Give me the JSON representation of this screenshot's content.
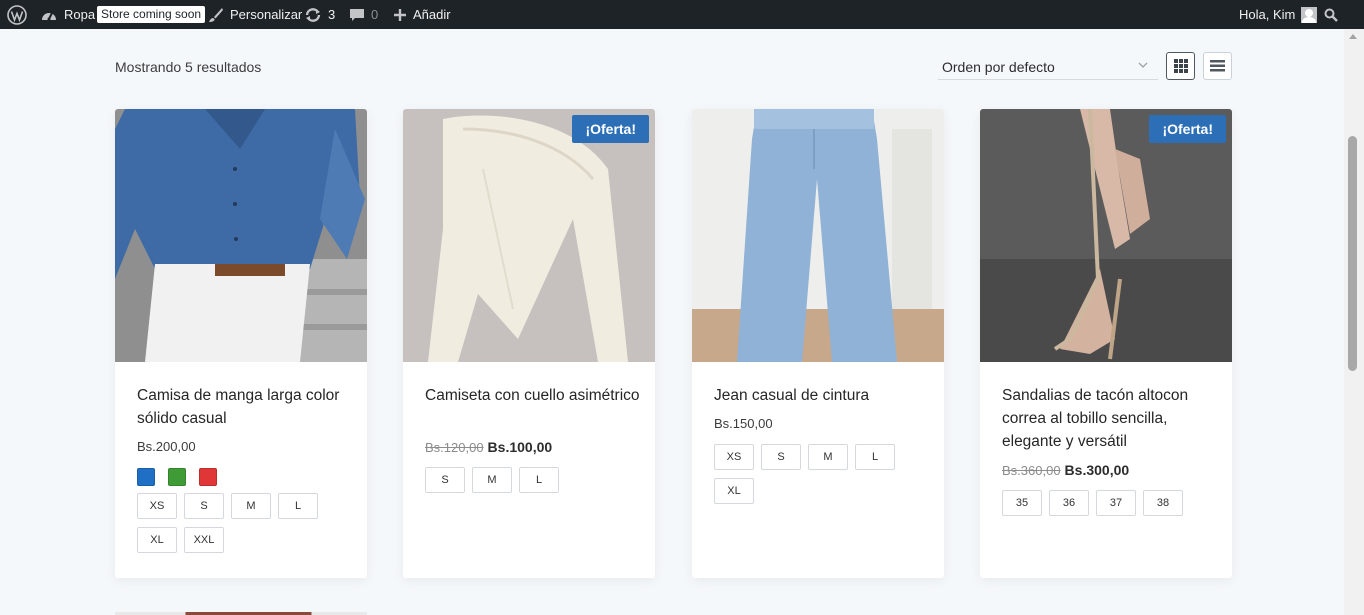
{
  "adminbar": {
    "site_name": "Ropa",
    "store_status": "Store coming soon",
    "customize": "Personalizar",
    "updates": "3",
    "comments": "0",
    "add_new": "Añadir",
    "greeting": "Hola, Kim"
  },
  "shop": {
    "result_count": "Mostrando 5 resultados",
    "orderby": "Orden por defecto"
  },
  "products": [
    {
      "title": "Camisa de manga larga color sólido casual",
      "price": "Bs.200,00",
      "colors": [
        "#1f6fc4",
        "#3f9b35",
        "#e03636"
      ],
      "sizes": [
        "XS",
        "S",
        "M",
        "L",
        "XL",
        "XXL"
      ]
    },
    {
      "title": "Camiseta con cuello asimétrico",
      "regular_price": "Bs.120,00",
      "sale_price": "Bs.100,00",
      "badge": "¡Oferta!",
      "sizes": [
        "S",
        "M",
        "L"
      ]
    },
    {
      "title": "Jean casual de cintura",
      "price": "Bs.150,00",
      "sizes": [
        "XS",
        "S",
        "M",
        "L",
        "XL"
      ]
    },
    {
      "title": "Sandalias de tacón altocon correa al tobillo sencilla, elegante y versátil",
      "regular_price": "Bs.360,00",
      "sale_price": "Bs.300,00",
      "badge": "¡Oferta!",
      "sizes": [
        "35",
        "36",
        "37",
        "38"
      ]
    }
  ],
  "colors": {
    "adminbar_bg": "#1d2327",
    "sale_badge": "#2c6fb7",
    "page_bg": "#f5f8fb"
  }
}
